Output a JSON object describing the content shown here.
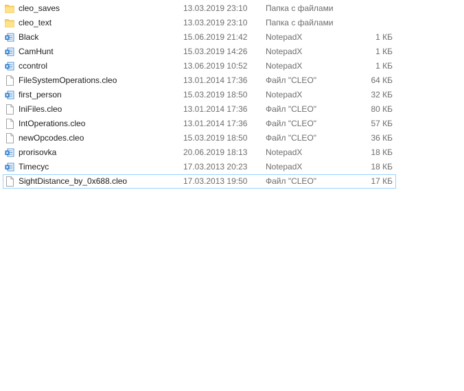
{
  "files": [
    {
      "name": "cleo_saves",
      "date": "13.03.2019 23:10",
      "type": "Папка с файлами",
      "size": "",
      "icon": "folder-icon"
    },
    {
      "name": "cleo_text",
      "date": "13.03.2019 23:10",
      "type": "Папка с файлами",
      "size": "",
      "icon": "folder-icon"
    },
    {
      "name": "Black",
      "date": "15.06.2019 21:42",
      "type": "NotepadX",
      "size": "1 КБ",
      "icon": "notepadx-icon"
    },
    {
      "name": "CamHunt",
      "date": "15.03.2019 14:26",
      "type": "NotepadX",
      "size": "1 КБ",
      "icon": "notepadx-icon"
    },
    {
      "name": "ccontrol",
      "date": "13.06.2019 10:52",
      "type": "NotepadX",
      "size": "1 КБ",
      "icon": "notepadx-icon"
    },
    {
      "name": "FileSystemOperations.cleo",
      "date": "13.01.2014 17:36",
      "type": "Файл \"CLEO\"",
      "size": "64 КБ",
      "icon": "file-icon"
    },
    {
      "name": "first_person",
      "date": "15.03.2019 18:50",
      "type": "NotepadX",
      "size": "32 КБ",
      "icon": "notepadx-icon"
    },
    {
      "name": "IniFiles.cleo",
      "date": "13.01.2014 17:36",
      "type": "Файл \"CLEO\"",
      "size": "80 КБ",
      "icon": "file-icon"
    },
    {
      "name": "IntOperations.cleo",
      "date": "13.01.2014 17:36",
      "type": "Файл \"CLEO\"",
      "size": "57 КБ",
      "icon": "file-icon"
    },
    {
      "name": "newOpcodes.cleo",
      "date": "15.03.2019 18:50",
      "type": "Файл \"CLEO\"",
      "size": "36 КБ",
      "icon": "file-icon"
    },
    {
      "name": "prorisovka",
      "date": "20.06.2019 18:13",
      "type": "NotepadX",
      "size": "18 КБ",
      "icon": "notepadx-icon"
    },
    {
      "name": "Timecyc",
      "date": "17.03.2013 20:23",
      "type": "NotepadX",
      "size": "18 КБ",
      "icon": "notepadx-icon"
    },
    {
      "name": "SightDistance_by_0x688.cleo",
      "date": "17.03.2013 19:50",
      "type": "Файл \"CLEO\"",
      "size": "17 КБ",
      "icon": "file-icon",
      "selected": true
    }
  ],
  "colors": {
    "folder": "#ffd35a",
    "notepadx": "#1e73c8",
    "selection_border": "#99d1ff"
  }
}
